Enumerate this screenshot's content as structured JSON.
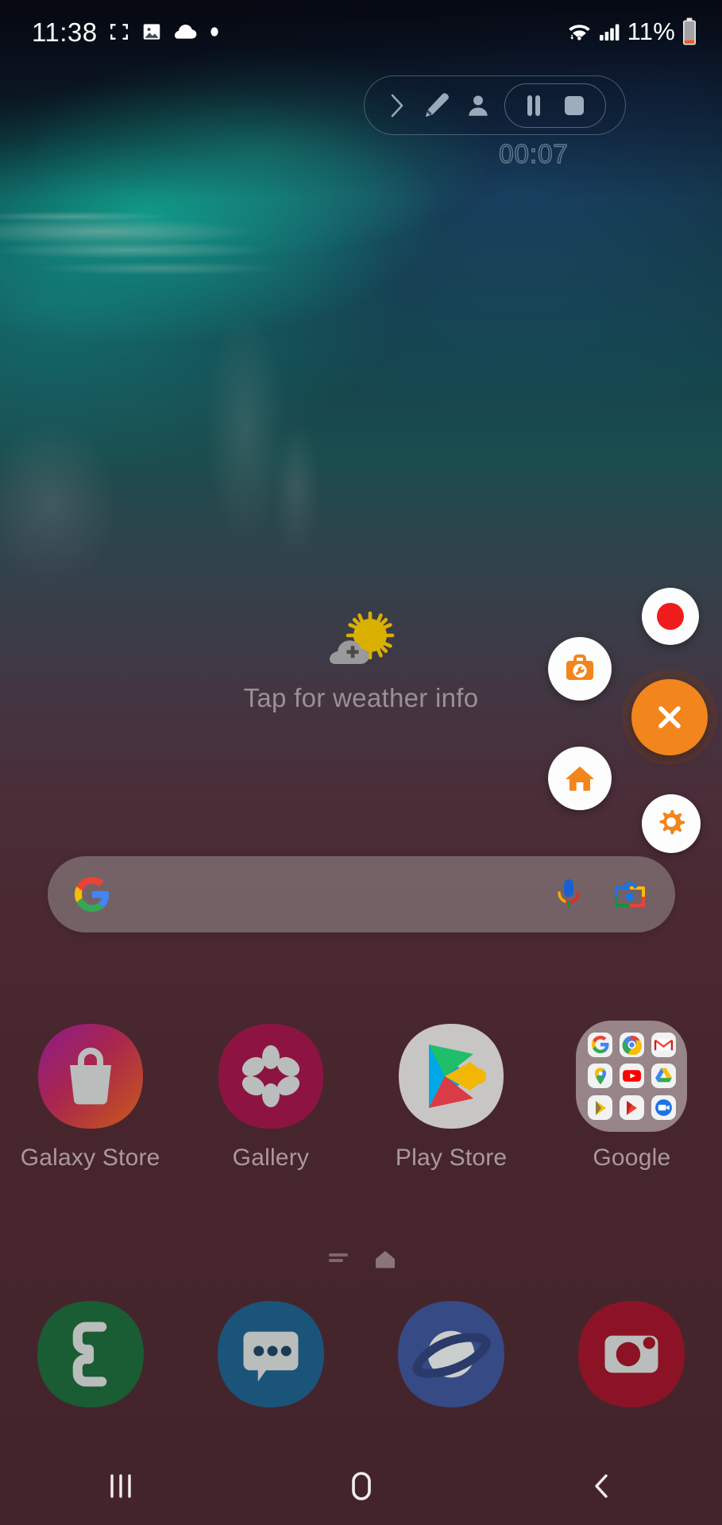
{
  "statusbar": {
    "time": "11:38",
    "battery_text": "11%",
    "icons": [
      "screenshot-crop-icon",
      "image-icon",
      "cloud-icon",
      "dot-icon",
      "wifi-icon",
      "signal-icon",
      "battery-icon"
    ],
    "battery_level_pct": 11
  },
  "screen_recorder": {
    "timer": "00:07",
    "expand_label": "Expand",
    "draw_label": "Draw",
    "selfie_label": "Selfie video",
    "pause_label": "Pause",
    "stop_label": "Stop"
  },
  "weather": {
    "text": "Tap for weather info"
  },
  "search": {
    "value": "",
    "placeholder": "",
    "logo": "google-g-logo",
    "mic": "microphone-icon",
    "lens": "google-lens-icon"
  },
  "apps": [
    {
      "label": "Galaxy Store",
      "icon": "galaxy-store-icon"
    },
    {
      "label": "Gallery",
      "icon": "gallery-icon"
    },
    {
      "label": "Play Store",
      "icon": "play-store-icon"
    },
    {
      "label": "Google",
      "icon": "google-folder-icon",
      "folder_items": [
        "Google",
        "Chrome",
        "Gmail",
        "Maps",
        "YouTube",
        "Drive",
        "Play Music",
        "Play Movies",
        "Duo"
      ]
    }
  ],
  "page_indicator": {
    "pages": [
      "apps-list-page",
      "home-page"
    ],
    "active_index": 1
  },
  "dock": [
    {
      "label": "Phone",
      "icon": "phone-icon"
    },
    {
      "label": "Messages",
      "icon": "messages-icon"
    },
    {
      "label": "Samsung Internet",
      "icon": "internet-icon"
    },
    {
      "label": "Camera",
      "icon": "camera-icon"
    }
  ],
  "navbar": {
    "recents_label": "Recents",
    "home_label": "Home",
    "back_label": "Back"
  },
  "assistive_menu": {
    "record_label": "Record",
    "toolkit_label": "Toolkit",
    "home_label": "Home",
    "settings_label": "Settings",
    "close_label": "Close"
  },
  "colors": {
    "accent_orange": "#f2851c",
    "record_red": "#f01b1b",
    "status_white": "#ffffff",
    "battery_low": "#ef5a27",
    "wallpaper_top": "#0d2a36",
    "wallpaper_teal": "#1d5f60",
    "wallpaper_bottom": "#512e37"
  }
}
